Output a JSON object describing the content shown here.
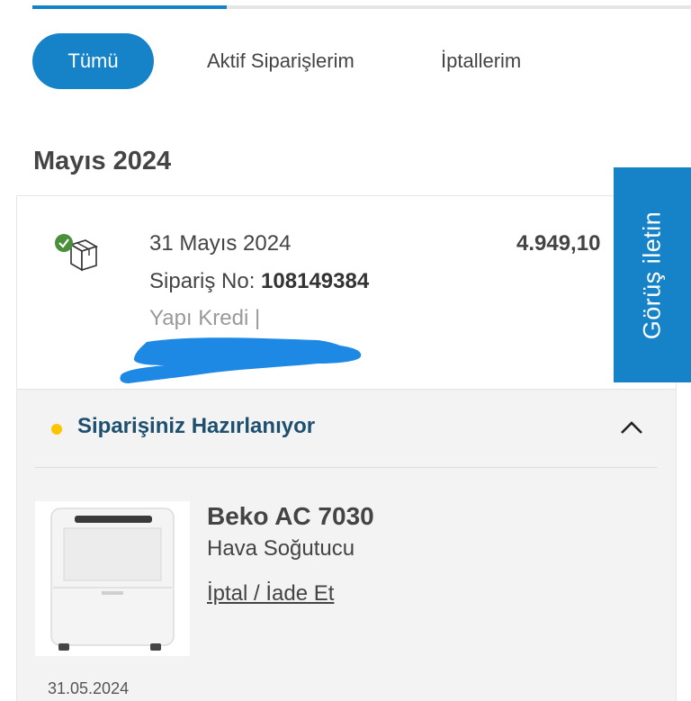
{
  "tabs": [
    {
      "label": "Tümü",
      "active": true
    },
    {
      "label": "Aktif Siparişlerim",
      "active": false
    },
    {
      "label": "İptallerim",
      "active": false
    }
  ],
  "month_heading": "Mayıs 2024",
  "order": {
    "date": "31 Mayıs 2024",
    "number_label": "Sipariş No:",
    "number": "108149384",
    "amount": "4.949,10",
    "payment": "Yapı Kredi |",
    "status": "Siparişiniz Hazırlanıyor",
    "status_color": "#ffc400",
    "product": {
      "name": "Beko AC 7030",
      "category": "Hava Soğutucu",
      "action": "İptal / İade Et"
    },
    "bottom_date": "31.05.2024"
  },
  "feedback_button": "Görüş iletin",
  "colors": {
    "brand": "#1683c9",
    "status_text": "#1d4f6f"
  },
  "icons": [
    "package-check-icon",
    "chevron-up-icon"
  ]
}
